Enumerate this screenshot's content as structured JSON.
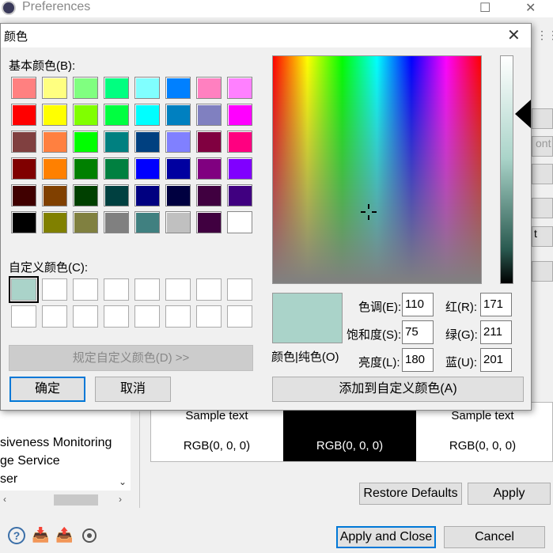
{
  "background": {
    "window_title": "Preferences",
    "right_fragments": [
      "ont",
      "t"
    ],
    "tree_items": [
      "siveness Monitoring",
      "ge Service",
      "ser"
    ],
    "sample_table": {
      "sample_text": "Sample text",
      "rgb_text": "RGB(0, 0, 0)"
    },
    "restore_defaults": "Restore Defaults",
    "apply": "Apply",
    "apply_and_close": "Apply and Close",
    "cancel": "Cancel"
  },
  "dialog": {
    "title": "颜色",
    "basic_colors_label": "基本颜色(B):",
    "basic_colors": [
      "#ff8080",
      "#ffff80",
      "#80ff80",
      "#00ff80",
      "#80ffff",
      "#0080ff",
      "#ff80c0",
      "#ff80ff",
      "#ff0000",
      "#ffff00",
      "#80ff00",
      "#00ff40",
      "#00ffff",
      "#0080c0",
      "#8080c0",
      "#ff00ff",
      "#804040",
      "#ff8040",
      "#00ff00",
      "#008080",
      "#004080",
      "#8080ff",
      "#800040",
      "#ff0080",
      "#800000",
      "#ff8000",
      "#008000",
      "#008040",
      "#0000ff",
      "#0000a0",
      "#800080",
      "#8000ff",
      "#400000",
      "#804000",
      "#004000",
      "#004040",
      "#000080",
      "#000040",
      "#400040",
      "#400080",
      "#000000",
      "#808000",
      "#808040",
      "#808080",
      "#408080",
      "#c0c0c0",
      "#400040",
      "#ffffff"
    ],
    "custom_colors_label": "自定义颜色(C):",
    "custom_colors": [
      "#aad3c9",
      "#ffffff",
      "#ffffff",
      "#ffffff",
      "#ffffff",
      "#ffffff",
      "#ffffff",
      "#ffffff",
      "#ffffff",
      "#ffffff",
      "#ffffff",
      "#ffffff",
      "#ffffff",
      "#ffffff",
      "#ffffff",
      "#ffffff"
    ],
    "define_custom_button": "规定自定义颜色(D) >>",
    "ok_button": "确定",
    "cancel_button": "取消",
    "color_solid_label": "颜色|纯色(O)",
    "hue_label": "色调(E):",
    "hue": "110",
    "sat_label": "饱和度(S):",
    "sat": "75",
    "lum_label": "亮度(L):",
    "lum": "180",
    "red_label": "红(R):",
    "red": "171",
    "green_label": "绿(G):",
    "green": "211",
    "blue_label": "蓝(U):",
    "blue": "201",
    "add_custom_button": "添加到自定义颜色(A)",
    "preview_color": "#aad3c9"
  }
}
